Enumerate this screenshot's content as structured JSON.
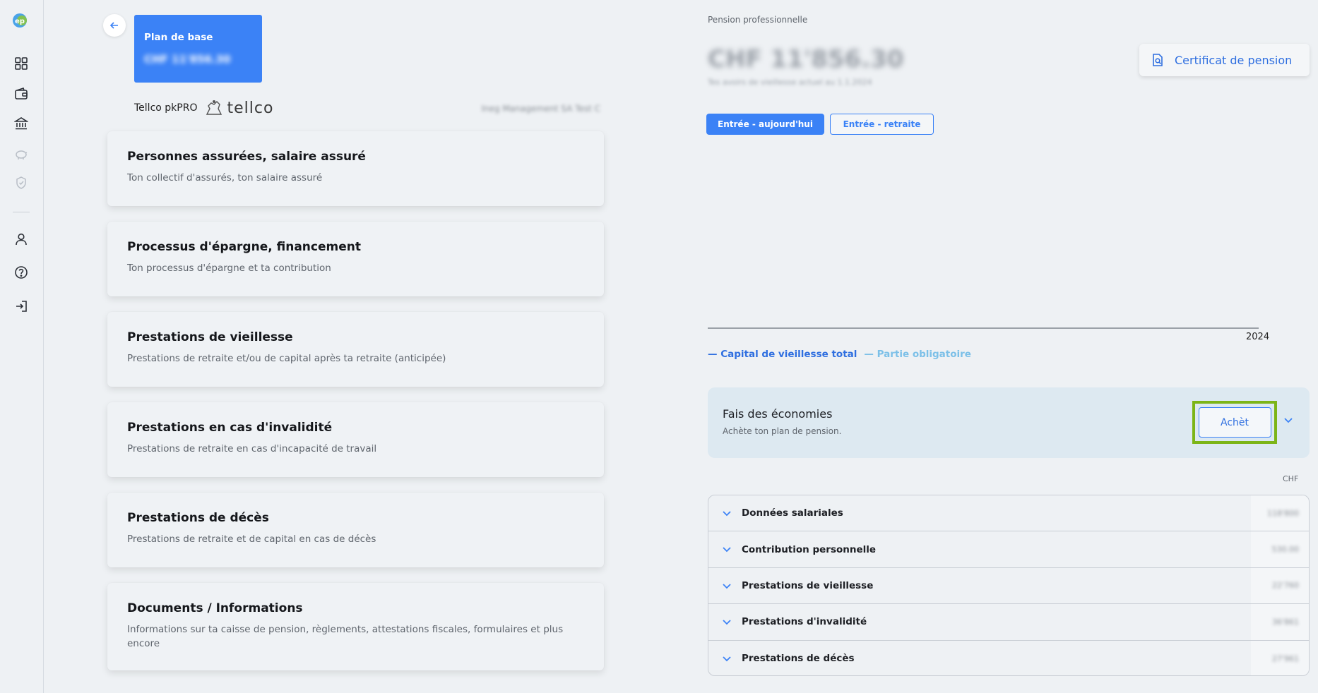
{
  "sidebar": {
    "logo": "ep",
    "icons": [
      "dashboard-icon",
      "wallet-icon",
      "bank-icon",
      "piggy-bank-icon",
      "shield-icon",
      "user-icon",
      "help-icon",
      "logout-icon"
    ]
  },
  "plan": {
    "title": "Plan de base",
    "amount": "CHF 11'856.30"
  },
  "provider": {
    "name": "Tellco pkPRO",
    "brand": "tellco"
  },
  "employer": "Ineg Management SA Test C",
  "menu": [
    {
      "title": "Personnes assurées, salaire assuré",
      "subtitle": "Ton collectif d'assurés, ton salaire assuré"
    },
    {
      "title": "Processus d'épargne, financement",
      "subtitle": "Ton processus d'épargne et ta contribution"
    },
    {
      "title": "Prestations de vieillesse",
      "subtitle": "Prestations de retraite et/ou de capital après ta retraite (anticipée)"
    },
    {
      "title": "Prestations en cas d'invalidité",
      "subtitle": "Prestations de retraite en cas d'incapacité de travail"
    },
    {
      "title": "Prestations de décès",
      "subtitle": "Prestations de retraite et de capital en cas de décès"
    },
    {
      "title": "Documents / Informations",
      "subtitle": "Informations sur ta caisse de pension, règlements, attestations fiscales, formulaires et plus encore"
    }
  ],
  "right": {
    "label": "Pension professionnelle",
    "amount": "CHF 11'856.30",
    "sub": "Tes avoirs de vieillesse actuel au 1.1.2024",
    "certificate_button": "Certificat de pension",
    "tabs": [
      "Entrée - aujourd'hui",
      "Entrée - retraite"
    ],
    "chart": {
      "x_tick": "2024"
    },
    "legend": [
      "— Capital de vieillesse total",
      "— Partie obligatoire"
    ],
    "savings": {
      "title": "Fais des économies",
      "subtitle": "Achète ton plan de pension.",
      "button": "Achèt"
    },
    "currency": "CHF",
    "accordion": [
      {
        "label": "Données salariales",
        "value": "118'800"
      },
      {
        "label": "Contribution personnelle",
        "value": "530.00"
      },
      {
        "label": "Prestations de vieillesse",
        "value": "22'760"
      },
      {
        "label": "Prestations d'invalidité",
        "value": "36'861"
      },
      {
        "label": "Prestations de décès",
        "value": "27'961"
      }
    ]
  },
  "colors": {
    "accent": "#3b82f6",
    "highlight": "#7cb518",
    "legend_secondary": "#7cc0e8"
  }
}
